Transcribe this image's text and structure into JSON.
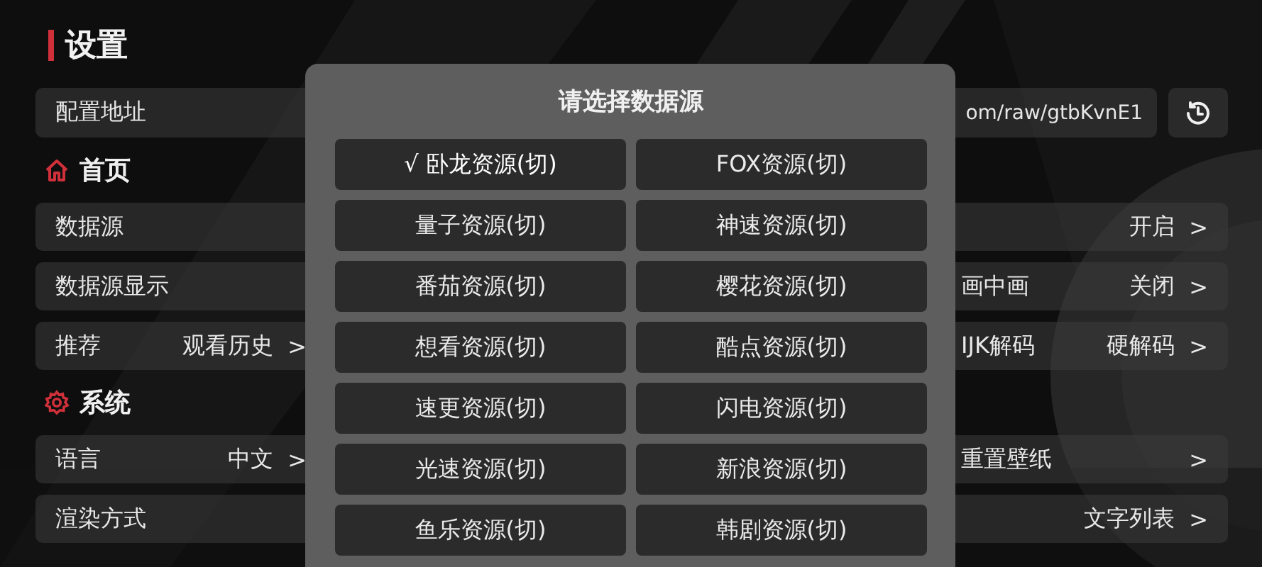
{
  "title": "设置",
  "config": {
    "label": "配置地址",
    "value": "om/raw/gtbKvnE1"
  },
  "sections": [
    {
      "kind": "home",
      "title": "首页",
      "left_rows": [
        {
          "label": "数据源"
        },
        {
          "label": "数据源显示"
        },
        {
          "label": "推荐",
          "value": "观看历史",
          "chevron": ">"
        }
      ],
      "right_rows": [
        {
          "value": "开启",
          "chevron": ">"
        },
        {
          "label": "画中画",
          "value": "关闭",
          "chevron": ">"
        },
        {
          "label": "IJK解码",
          "value": "硬解码",
          "chevron": ">"
        }
      ]
    },
    {
      "kind": "system",
      "title": "系统",
      "left_rows": [
        {
          "label": "语言",
          "value": "中文",
          "chevron": ">"
        },
        {
          "label": "渲染方式"
        }
      ],
      "right_rows": [
        {
          "label": "重置壁纸",
          "chevron": ">"
        },
        {
          "value": "文字列表",
          "chevron": ">"
        }
      ]
    }
  ],
  "dialog": {
    "title": "请选择数据源",
    "check": "√",
    "options": [
      {
        "label": "卧龙资源(切)",
        "selected": true
      },
      {
        "label": "FOX资源(切)",
        "selected": false
      },
      {
        "label": "量子资源(切)",
        "selected": false
      },
      {
        "label": "神速资源(切)",
        "selected": false
      },
      {
        "label": "番茄资源(切)",
        "selected": false
      },
      {
        "label": "樱花资源(切)",
        "selected": false
      },
      {
        "label": "想看资源(切)",
        "selected": false
      },
      {
        "label": "酷点资源(切)",
        "selected": false
      },
      {
        "label": "速更资源(切)",
        "selected": false
      },
      {
        "label": "闪电资源(切)",
        "selected": false
      },
      {
        "label": "光速资源(切)",
        "selected": false
      },
      {
        "label": "新浪资源(切)",
        "selected": false
      },
      {
        "label": "鱼乐资源(切)",
        "selected": false
      },
      {
        "label": "韩剧资源(切)",
        "selected": false
      }
    ]
  }
}
